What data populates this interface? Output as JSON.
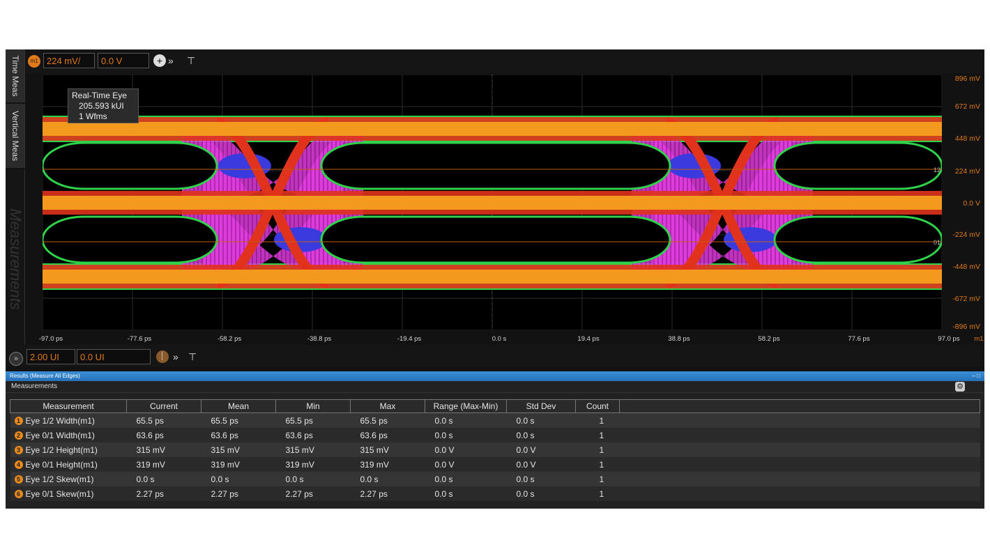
{
  "side_tabs": {
    "time_meas": "Time Meas",
    "vertical_meas": "Vertical Meas",
    "measurements": "Measurements"
  },
  "top_toolbar": {
    "channel_badge": "m1",
    "vertical_scale": "224 mV/",
    "vertical_offset": "0.0 V"
  },
  "tooltip": {
    "line1": "Real-Time Eye",
    "line2": "205.593 kUI",
    "line3": "1 Wfms"
  },
  "y_axis_labels": [
    "896 mV",
    "672 mV",
    "448 mV",
    "224 mV",
    "0.0 V",
    "-224 mV",
    "-448 mV",
    "-672 mV",
    "-896 mV"
  ],
  "x_axis_labels": [
    "-97.0 ps",
    "-77.6 ps",
    "-58.2 ps",
    "-38.8 ps",
    "-19.4 ps",
    "0.0 s",
    "19.4 ps",
    "38.8 ps",
    "58.2 ps",
    "77.6 ps",
    "97.0 ps"
  ],
  "x_axis_unit": "m1",
  "level_markers": {
    "upper": "12",
    "lower": "01",
    "channel": "m1"
  },
  "bottom_toolbar": {
    "horizontal_scale": "2.00 UI",
    "horizontal_position": "0.0 UI"
  },
  "results": {
    "header": "Results (Measure All Edges)",
    "section_title": "Measurements",
    "columns": [
      "Measurement",
      "Current",
      "Mean",
      "Min",
      "Max",
      "Range (Max-Min)",
      "Std Dev",
      "Count"
    ],
    "rows": [
      {
        "index": "1",
        "name": "Eye 1/2 Width(m1)",
        "current": "65.5 ps",
        "mean": "65.5 ps",
        "min": "65.5 ps",
        "max": "65.5 ps",
        "range": "0.0 s",
        "std": "0.0 s",
        "count": "1"
      },
      {
        "index": "2",
        "name": "Eye 0/1 Width(m1)",
        "current": "63.6 ps",
        "mean": "63.6 ps",
        "min": "63.6 ps",
        "max": "63.6 ps",
        "range": "0.0 s",
        "std": "0.0 s",
        "count": "1"
      },
      {
        "index": "3",
        "name": "Eye 1/2 Height(m1)",
        "current": "315 mV",
        "mean": "315 mV",
        "min": "315 mV",
        "max": "315 mV",
        "range": "0.0 V",
        "std": "0.0 V",
        "count": "1"
      },
      {
        "index": "4",
        "name": "Eye 0/1 Height(m1)",
        "current": "319 mV",
        "mean": "319 mV",
        "min": "319 mV",
        "max": "319 mV",
        "range": "0.0 V",
        "std": "0.0 V",
        "count": "1"
      },
      {
        "index": "5",
        "name": "Eye 1/2 Skew(m1)",
        "current": "0.0 s",
        "mean": "0.0 s",
        "min": "0.0 s",
        "max": "0.0 s",
        "range": "0.0 s",
        "std": "0.0 s",
        "count": "1"
      },
      {
        "index": "6",
        "name": "Eye 0/1 Skew(m1)",
        "current": "2.27 ps",
        "mean": "2.27 ps",
        "min": "2.27 ps",
        "max": "2.27 ps",
        "range": "0.0 s",
        "std": "0.0 s",
        "count": "1"
      }
    ]
  },
  "colors": {
    "accent_orange": "#e07a1b",
    "eye_red": "#e0321c",
    "eye_orange": "#f39a1e",
    "eye_magenta": "#e23ce0",
    "eye_blue": "#3a3adf",
    "eye_green": "#2fd24a",
    "results_header": "#2f80c9"
  }
}
